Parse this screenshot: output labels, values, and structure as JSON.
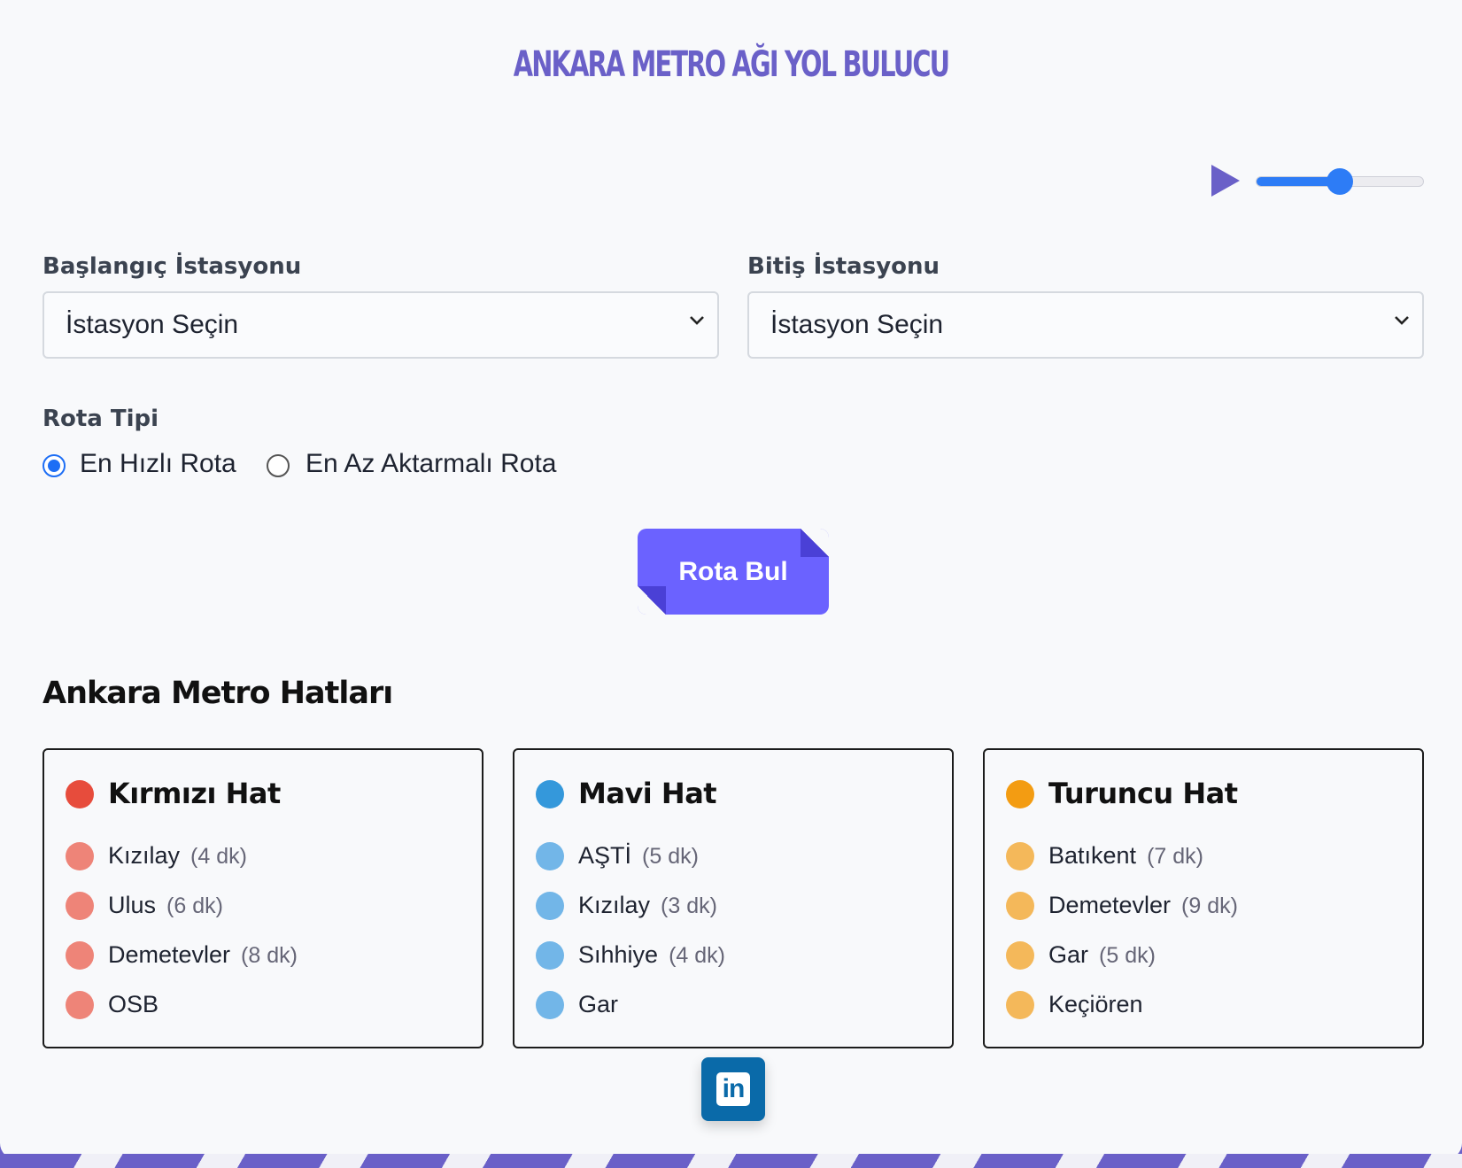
{
  "title": "ANKARA METRO AĞI YOL BULUCU",
  "audio": {
    "play_icon": "play-icon",
    "volume": 0.5
  },
  "start": {
    "label": "Başlangıç İstasyonu",
    "selected": "İstasyon Seçin"
  },
  "end": {
    "label": "Bitiş İstasyonu",
    "selected": "İstasyon Seçin"
  },
  "route_type": {
    "label": "Rota Tipi",
    "options": [
      {
        "label": "En Hızlı Rota",
        "checked": true
      },
      {
        "label": "En Az Aktarmalı Rota",
        "checked": false
      }
    ]
  },
  "find_button": "Rota Bul",
  "lines_title": "Ankara Metro Hatları",
  "lines": [
    {
      "name": "Kırmızı Hat",
      "color": "#e74c3c",
      "station_color": "#ee8478",
      "stations": [
        {
          "name": "Kızılay",
          "time": "(4 dk)"
        },
        {
          "name": "Ulus",
          "time": "(6 dk)"
        },
        {
          "name": "Demetevler",
          "time": "(8 dk)"
        },
        {
          "name": "OSB",
          "time": ""
        }
      ]
    },
    {
      "name": "Mavi Hat",
      "color": "#3498db",
      "station_color": "#72b6e8",
      "stations": [
        {
          "name": "AŞTİ",
          "time": "(5 dk)"
        },
        {
          "name": "Kızılay",
          "time": "(3 dk)"
        },
        {
          "name": "Sıhhiye",
          "time": "(4 dk)"
        },
        {
          "name": "Gar",
          "time": ""
        }
      ]
    },
    {
      "name": "Turuncu Hat",
      "color": "#f39c12",
      "station_color": "#f4b85a",
      "stations": [
        {
          "name": "Batıkent",
          "time": "(7 dk)"
        },
        {
          "name": "Demetevler",
          "time": "(9 dk)"
        },
        {
          "name": "Gar",
          "time": "(5 dk)"
        },
        {
          "name": "Keçiören",
          "time": ""
        }
      ]
    }
  ],
  "linkedin": {
    "icon": "linkedin-icon",
    "text": "in"
  }
}
